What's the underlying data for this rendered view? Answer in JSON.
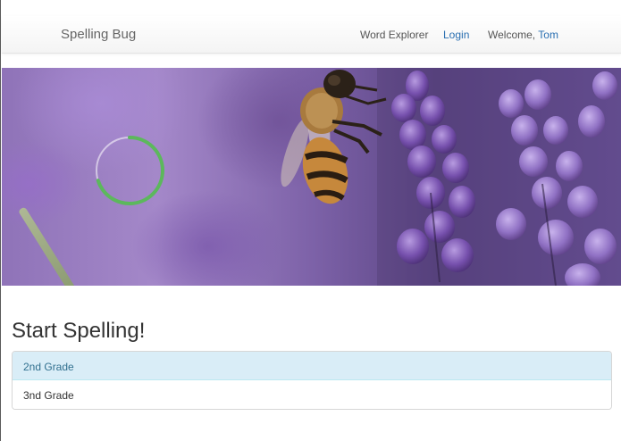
{
  "navbar": {
    "brand": "Spelling Bug",
    "links": [
      {
        "label": "Word Explorer"
      },
      {
        "label": "Login"
      }
    ],
    "welcome_prefix": "Welcome,",
    "user_name": "Tom"
  },
  "hero": {
    "image_subject": "bee-on-lavender-photo",
    "loading_progress": 0.7,
    "spinner_color": "#5cb85c"
  },
  "main": {
    "heading": "Start Spelling!",
    "grades": [
      {
        "label": "2nd Grade",
        "state": "active"
      },
      {
        "label": "3nd Grade",
        "state": "default"
      }
    ]
  },
  "colors": {
    "link": "#2a6fb1",
    "active_item_bg": "#d9edf7",
    "active_item_text": "#31708f"
  }
}
